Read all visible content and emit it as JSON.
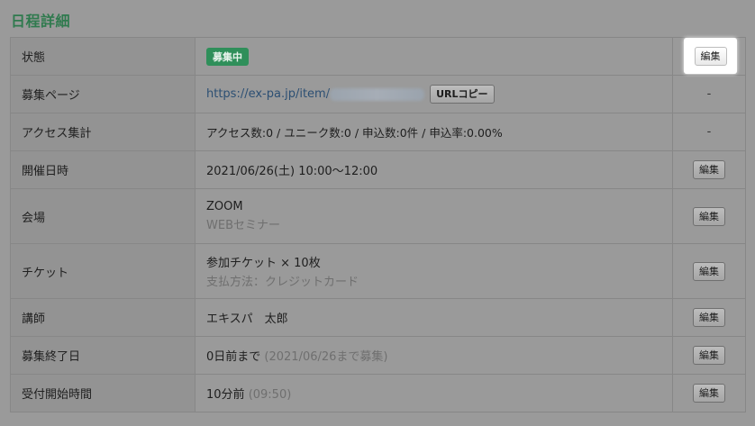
{
  "title": "日程詳細",
  "rows": [
    {
      "label": "状態",
      "badge": "募集中",
      "action": "編集"
    },
    {
      "label": "募集ページ",
      "url_prefix": "https://ex-pa.jp/item/",
      "copy_button": "URLコピー",
      "action": "-"
    },
    {
      "label": "アクセス集計",
      "value": "アクセス数:0 / ユニーク数:0 / 申込数:0件 / 申込率:0.00%",
      "action": "-"
    },
    {
      "label": "開催日時",
      "value": "2021/06/26(土) 10:00〜12:00",
      "action": "編集"
    },
    {
      "label": "会場",
      "value": "ZOOM",
      "sub": "WEBセミナー",
      "action": "編集"
    },
    {
      "label": "チケット",
      "value": "参加チケット × 10枚",
      "sub": "支払方法：クレジットカード",
      "action": "編集"
    },
    {
      "label": "講師",
      "value": "エキスパ　太郎",
      "action": "編集"
    },
    {
      "label": "募集終了日",
      "value": "0日前まで",
      "paren": "(2021/06/26まで募集)",
      "action": "編集"
    },
    {
      "label": "受付開始時間",
      "value": "10分前",
      "paren": "(09:50)",
      "action": "編集"
    }
  ]
}
